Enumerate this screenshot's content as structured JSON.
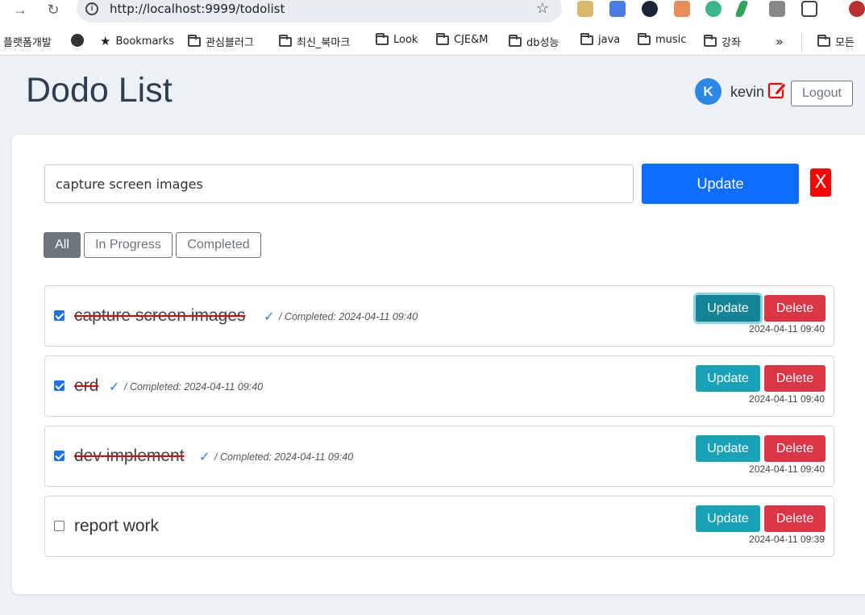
{
  "browser": {
    "url": "http://localhost:9999/todolist",
    "bookmarks": [
      {
        "label": "플랫폼개발",
        "icon": "none"
      },
      {
        "label": "",
        "icon": "globe-icon"
      },
      {
        "label": "Bookmarks",
        "icon": "star-icon"
      },
      {
        "label": "관심블러그",
        "icon": "folder-icon"
      },
      {
        "label": "최신_북마크",
        "icon": "folder-icon"
      },
      {
        "label": "Look",
        "icon": "folder-icon"
      },
      {
        "label": "CJE&M",
        "icon": "folder-icon"
      },
      {
        "label": "db성능",
        "icon": "folder-icon"
      },
      {
        "label": "java",
        "icon": "folder-icon"
      },
      {
        "label": "music",
        "icon": "folder-icon"
      },
      {
        "label": "강좌",
        "icon": "folder-icon"
      },
      {
        "label": "»",
        "icon": "none"
      },
      {
        "label": "모든",
        "icon": "folder-icon"
      }
    ]
  },
  "header": {
    "title": "Dodo List",
    "avatar_letter": "K",
    "username": "kevin",
    "logout_label": "Logout"
  },
  "editor": {
    "input_value": "capture screen images",
    "update_label": "Update",
    "cancel_label": "X"
  },
  "filters": [
    {
      "label": "All",
      "active": true
    },
    {
      "label": "In Progress",
      "active": false
    },
    {
      "label": "Completed",
      "active": false
    }
  ],
  "todos": [
    {
      "title": "capture screen images",
      "checked": true,
      "check_mark": "✓",
      "completed_note": "/ Completed: 2024-04-11 09:40",
      "update_label": "Update",
      "delete_label": "Delete",
      "date": "2024-04-11 09:40",
      "update_focused": true
    },
    {
      "title": "erd",
      "checked": true,
      "check_mark": "✓",
      "completed_note": "/ Completed: 2024-04-11 09:40",
      "update_label": "Update",
      "delete_label": "Delete",
      "date": "2024-04-11 09:40",
      "update_focused": false
    },
    {
      "title": "dev implement",
      "checked": true,
      "check_mark": "✓",
      "completed_note": "/ Completed: 2024-04-11 09:40",
      "update_label": "Update",
      "delete_label": "Delete",
      "date": "2024-04-11 09:40",
      "update_focused": false
    },
    {
      "title": "report work",
      "checked": false,
      "check_mark": "",
      "completed_note": "",
      "update_label": "Update",
      "delete_label": "Delete",
      "date": "2024-04-11 09:39",
      "update_focused": false
    }
  ],
  "colors": {
    "primary": "#0d6efd",
    "info": "#17a2b8",
    "danger": "#dc3545",
    "secondary": "#6c757d",
    "cancel": "#ff0000"
  }
}
